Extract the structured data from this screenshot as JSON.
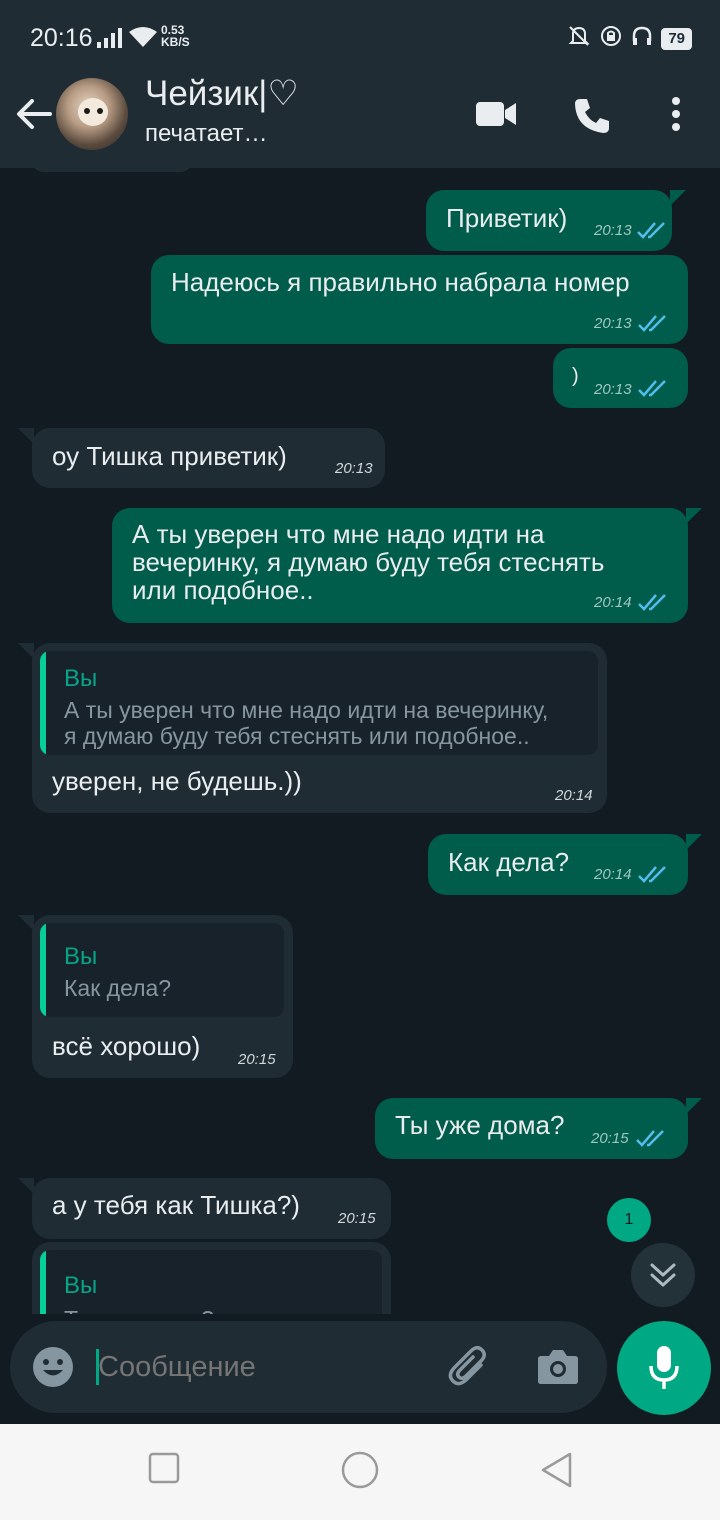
{
  "status_bar": {
    "time": "20:16",
    "net_speed_value": "0.53",
    "net_speed_unit": "KB/S",
    "battery": "79",
    "icons": [
      "signal-icon",
      "wifi-icon",
      "mute-bell-icon",
      "alarm-lock-icon",
      "headphones-icon",
      "battery-icon"
    ]
  },
  "header": {
    "contact_name": "Чейзик|♡",
    "contact_status": "печатает…",
    "icons": [
      "back-arrow-icon",
      "video-call-icon",
      "phone-icon",
      "more-vert-icon"
    ]
  },
  "messages": [
    {
      "dir": "out",
      "text": "Приветик)",
      "time": "20:13",
      "status": "read"
    },
    {
      "dir": "out",
      "text": "Надеюсь я правильно набрала номер",
      "time": "20:13",
      "status": "read"
    },
    {
      "dir": "out",
      "text": ")",
      "time": "20:13",
      "status": "read"
    },
    {
      "dir": "in",
      "text": "оу Тишка приветик)",
      "time": "20:13"
    },
    {
      "dir": "out",
      "text": "А ты уверен что мне надо идти на\nвечеринку, я думаю буду тебя стеснять\nили подобное..",
      "time": "20:14",
      "status": "read"
    },
    {
      "dir": "in",
      "quote_author": "Вы",
      "quote_text": "А ты уверен что мне надо идти на вечеринку,\nя думаю буду тебя стеснять или подобное..",
      "text": "уверен, не будешь.))",
      "time": "20:14"
    },
    {
      "dir": "out",
      "text": "Как дела?",
      "time": "20:14",
      "status": "read"
    },
    {
      "dir": "in",
      "quote_author": "Вы",
      "quote_text": "Как дела?",
      "text": "всё хорошо)",
      "time": "20:15"
    },
    {
      "dir": "out",
      "text": "Ты уже дома?",
      "time": "20:15",
      "status": "read"
    },
    {
      "dir": "in",
      "text": "а у тебя как Тишка?)",
      "time": "20:15"
    },
    {
      "dir": "in",
      "quote_author": "Вы",
      "quote_text": "Ты уже дома?",
      "text": "",
      "time": ""
    }
  ],
  "unread_count": "1",
  "input": {
    "placeholder": "Сообщение"
  },
  "colors": {
    "background": "#121b22",
    "header": "#1f2c34",
    "outgoing_bubble": "#005c4b",
    "incoming_bubble": "#1f2c34",
    "accent": "#00a884",
    "read_ticks": "#53bdeb"
  }
}
